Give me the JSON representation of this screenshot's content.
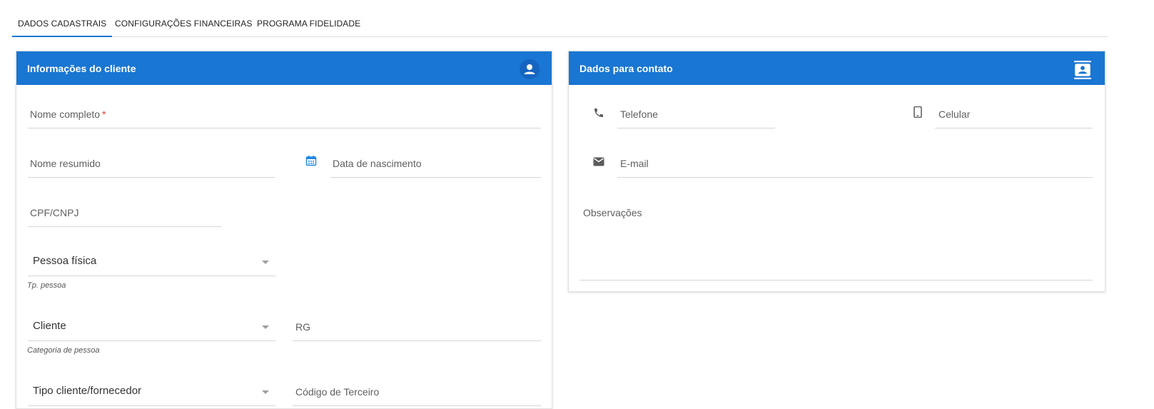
{
  "tabs": [
    {
      "label": "DADOS CADASTRAIS",
      "active": true
    },
    {
      "label": "CONFIGURAÇÕES FINANCEIRAS",
      "active": false
    },
    {
      "label": "PROGRAMA FIDELIDADE",
      "active": false
    }
  ],
  "colors": {
    "accent": "#1976d2",
    "required": "#e53935"
  },
  "client_card": {
    "title": "Informações do cliente",
    "icon": "person-icon",
    "full_name": {
      "label": "Nome completo",
      "required_mark": "*",
      "value": ""
    },
    "short_name": {
      "label": "Nome resumido",
      "value": ""
    },
    "birth_date": {
      "label": "Data de nascimento",
      "icon": "calendar-icon",
      "value": ""
    },
    "document": {
      "label": "CPF/CNPJ",
      "value": ""
    },
    "person_type": {
      "value": "Pessoa física",
      "hint": "Tp. pessoa"
    },
    "person_category": {
      "value": "Cliente",
      "hint": "Categoria de pessoa"
    },
    "rg": {
      "label": "RG",
      "value": ""
    },
    "client_supplier_type": {
      "value": "Tipo cliente/fornecedor"
    },
    "third_party_code": {
      "label": "Código de Terceiro",
      "value": ""
    }
  },
  "contact_card": {
    "title": "Dados para contato",
    "icon": "contact-card-icon",
    "phone": {
      "label": "Telefone",
      "icon": "phone-icon",
      "value": ""
    },
    "mobile": {
      "label": "Celular",
      "icon": "smartphone-icon",
      "value": ""
    },
    "email": {
      "label": "E-mail",
      "icon": "mail-icon",
      "value": ""
    },
    "notes": {
      "label": "Observações",
      "value": ""
    }
  }
}
